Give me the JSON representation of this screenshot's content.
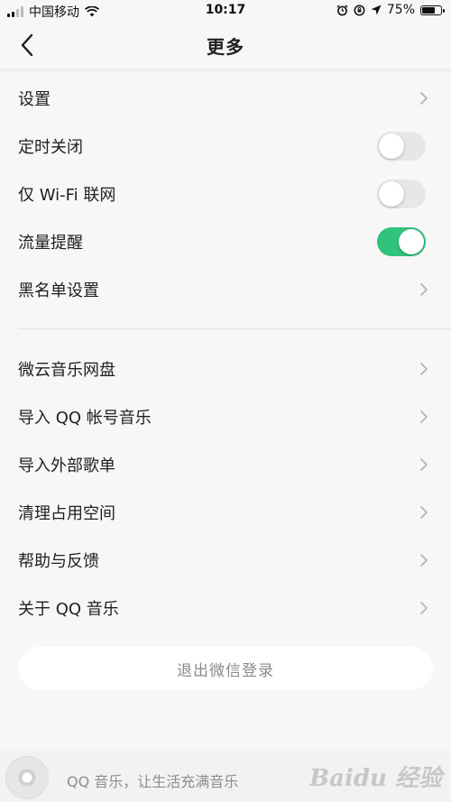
{
  "status_bar": {
    "carrier": "中国移动",
    "time": "10:17",
    "battery_text": "75%",
    "battery_level": 0.75
  },
  "nav": {
    "title": "更多",
    "back_icon": "chevron-left-icon"
  },
  "group1": [
    {
      "label": "设置",
      "control": "chevron"
    },
    {
      "label": "定时关闭",
      "control": "toggle",
      "on": false
    },
    {
      "label": "仅 Wi-Fi 联网",
      "control": "toggle",
      "on": false
    },
    {
      "label": "流量提醒",
      "control": "toggle",
      "on": true
    },
    {
      "label": "黑名单设置",
      "control": "chevron"
    }
  ],
  "group2": [
    {
      "label": "微云音乐网盘",
      "control": "chevron"
    },
    {
      "label": "导入 QQ 帐号音乐",
      "control": "chevron"
    },
    {
      "label": "导入外部歌单",
      "control": "chevron"
    },
    {
      "label": "清理占用空间",
      "control": "chevron"
    },
    {
      "label": "帮助与反馈",
      "control": "chevron"
    },
    {
      "label": "关于 QQ 音乐",
      "control": "chevron"
    }
  ],
  "logout_label": "退出微信登录",
  "player": {
    "text": "QQ 音乐，让生活充满音乐"
  },
  "watermark_text": "Baidu 经验",
  "colors": {
    "accent_green": "#31c27c",
    "toggle_off": "#e7e7e7",
    "background": "#f7f7f7"
  }
}
